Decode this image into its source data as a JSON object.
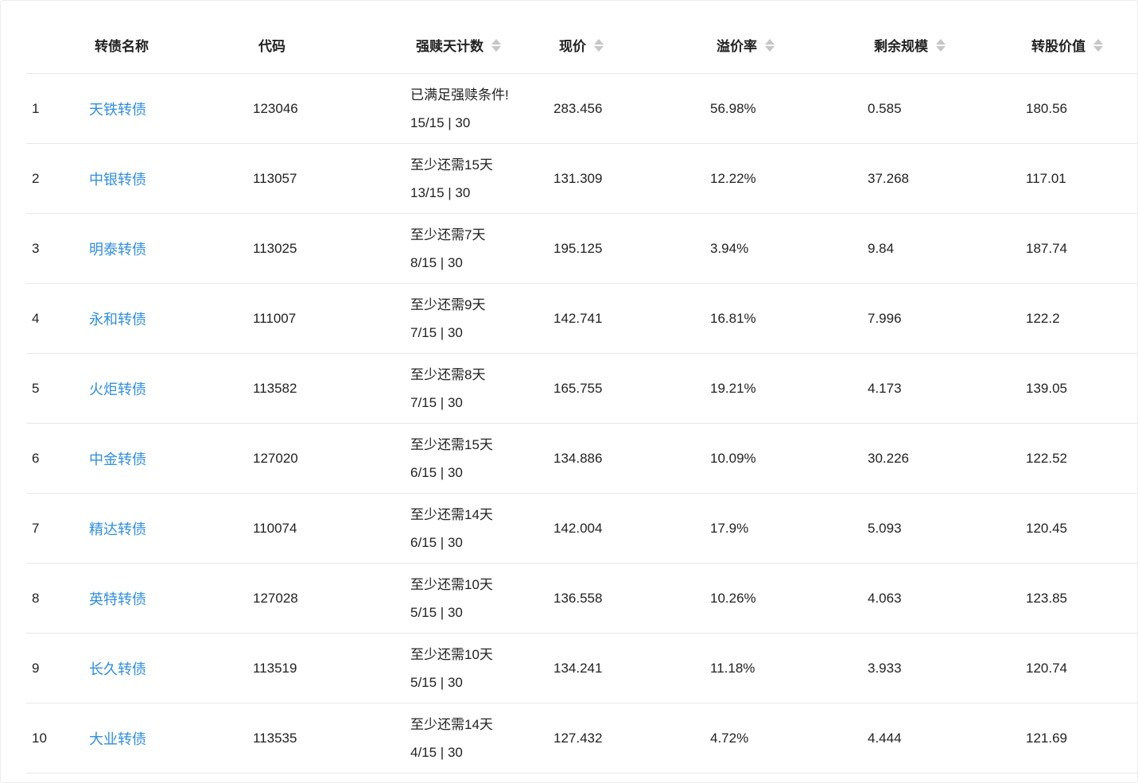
{
  "columns": {
    "name": "转债名称",
    "code": "代码",
    "redeem_days": "强赎天计数",
    "price": "现价",
    "premium": "溢价率",
    "scale": "剩余规模",
    "conv_value": "转股价值"
  },
  "sortable_columns": [
    "redeem_days",
    "price",
    "premium",
    "scale",
    "conv_value"
  ],
  "colors": {
    "link": "#2f8ee0",
    "text": "#222222",
    "border": "#e8e8e8",
    "sort_icon": "#c6c6c6"
  },
  "rows": [
    {
      "idx": "1",
      "name": "天铁转债",
      "code": "123046",
      "redeem_status": "已满足强赎条件!",
      "redeem_count": "15/15 | 30",
      "price": "283.456",
      "premium": "56.98%",
      "scale": "0.585",
      "conv_value": "180.56"
    },
    {
      "idx": "2",
      "name": "中银转债",
      "code": "113057",
      "redeem_status": "至少还需15天",
      "redeem_count": "13/15 | 30",
      "price": "131.309",
      "premium": "12.22%",
      "scale": "37.268",
      "conv_value": "117.01"
    },
    {
      "idx": "3",
      "name": "明泰转债",
      "code": "113025",
      "redeem_status": "至少还需7天",
      "redeem_count": "8/15 | 30",
      "price": "195.125",
      "premium": "3.94%",
      "scale": "9.84",
      "conv_value": "187.74"
    },
    {
      "idx": "4",
      "name": "永和转债",
      "code": "111007",
      "redeem_status": "至少还需9天",
      "redeem_count": "7/15 | 30",
      "price": "142.741",
      "premium": "16.81%",
      "scale": "7.996",
      "conv_value": "122.2"
    },
    {
      "idx": "5",
      "name": "火炬转债",
      "code": "113582",
      "redeem_status": "至少还需8天",
      "redeem_count": "7/15 | 30",
      "price": "165.755",
      "premium": "19.21%",
      "scale": "4.173",
      "conv_value": "139.05"
    },
    {
      "idx": "6",
      "name": "中金转债",
      "code": "127020",
      "redeem_status": "至少还需15天",
      "redeem_count": "6/15 | 30",
      "price": "134.886",
      "premium": "10.09%",
      "scale": "30.226",
      "conv_value": "122.52"
    },
    {
      "idx": "7",
      "name": "精达转债",
      "code": "110074",
      "redeem_status": "至少还需14天",
      "redeem_count": "6/15 | 30",
      "price": "142.004",
      "premium": "17.9%",
      "scale": "5.093",
      "conv_value": "120.45"
    },
    {
      "idx": "8",
      "name": "英特转债",
      "code": "127028",
      "redeem_status": "至少还需10天",
      "redeem_count": "5/15 | 30",
      "price": "136.558",
      "premium": "10.26%",
      "scale": "4.063",
      "conv_value": "123.85"
    },
    {
      "idx": "9",
      "name": "长久转债",
      "code": "113519",
      "redeem_status": "至少还需10天",
      "redeem_count": "5/15 | 30",
      "price": "134.241",
      "premium": "11.18%",
      "scale": "3.933",
      "conv_value": "120.74"
    },
    {
      "idx": "10",
      "name": "大业转债",
      "code": "113535",
      "redeem_status": "至少还需14天",
      "redeem_count": "4/15 | 30",
      "price": "127.432",
      "premium": "4.72%",
      "scale": "4.444",
      "conv_value": "121.69"
    }
  ]
}
